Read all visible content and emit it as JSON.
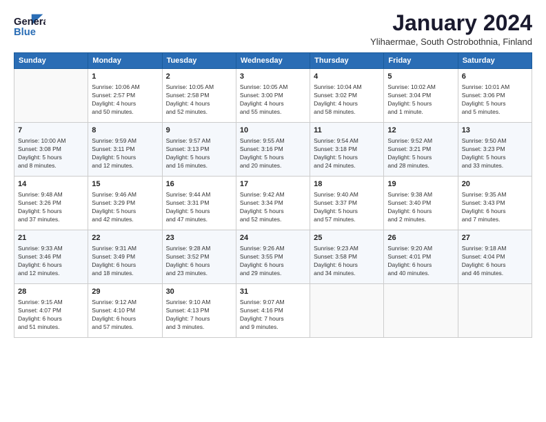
{
  "logo": {
    "line1": "General",
    "line2": "Blue"
  },
  "title": "January 2024",
  "subtitle": "Ylihaermae, South Ostrobothnia, Finland",
  "weekdays": [
    "Sunday",
    "Monday",
    "Tuesday",
    "Wednesday",
    "Thursday",
    "Friday",
    "Saturday"
  ],
  "weeks": [
    [
      {
        "day": "",
        "info": ""
      },
      {
        "day": "1",
        "info": "Sunrise: 10:06 AM\nSunset: 2:57 PM\nDaylight: 4 hours\nand 50 minutes."
      },
      {
        "day": "2",
        "info": "Sunrise: 10:05 AM\nSunset: 2:58 PM\nDaylight: 4 hours\nand 52 minutes."
      },
      {
        "day": "3",
        "info": "Sunrise: 10:05 AM\nSunset: 3:00 PM\nDaylight: 4 hours\nand 55 minutes."
      },
      {
        "day": "4",
        "info": "Sunrise: 10:04 AM\nSunset: 3:02 PM\nDaylight: 4 hours\nand 58 minutes."
      },
      {
        "day": "5",
        "info": "Sunrise: 10:02 AM\nSunset: 3:04 PM\nDaylight: 5 hours\nand 1 minute."
      },
      {
        "day": "6",
        "info": "Sunrise: 10:01 AM\nSunset: 3:06 PM\nDaylight: 5 hours\nand 5 minutes."
      }
    ],
    [
      {
        "day": "7",
        "info": "Sunrise: 10:00 AM\nSunset: 3:08 PM\nDaylight: 5 hours\nand 8 minutes."
      },
      {
        "day": "8",
        "info": "Sunrise: 9:59 AM\nSunset: 3:11 PM\nDaylight: 5 hours\nand 12 minutes."
      },
      {
        "day": "9",
        "info": "Sunrise: 9:57 AM\nSunset: 3:13 PM\nDaylight: 5 hours\nand 16 minutes."
      },
      {
        "day": "10",
        "info": "Sunrise: 9:55 AM\nSunset: 3:16 PM\nDaylight: 5 hours\nand 20 minutes."
      },
      {
        "day": "11",
        "info": "Sunrise: 9:54 AM\nSunset: 3:18 PM\nDaylight: 5 hours\nand 24 minutes."
      },
      {
        "day": "12",
        "info": "Sunrise: 9:52 AM\nSunset: 3:21 PM\nDaylight: 5 hours\nand 28 minutes."
      },
      {
        "day": "13",
        "info": "Sunrise: 9:50 AM\nSunset: 3:23 PM\nDaylight: 5 hours\nand 33 minutes."
      }
    ],
    [
      {
        "day": "14",
        "info": "Sunrise: 9:48 AM\nSunset: 3:26 PM\nDaylight: 5 hours\nand 37 minutes."
      },
      {
        "day": "15",
        "info": "Sunrise: 9:46 AM\nSunset: 3:29 PM\nDaylight: 5 hours\nand 42 minutes."
      },
      {
        "day": "16",
        "info": "Sunrise: 9:44 AM\nSunset: 3:31 PM\nDaylight: 5 hours\nand 47 minutes."
      },
      {
        "day": "17",
        "info": "Sunrise: 9:42 AM\nSunset: 3:34 PM\nDaylight: 5 hours\nand 52 minutes."
      },
      {
        "day": "18",
        "info": "Sunrise: 9:40 AM\nSunset: 3:37 PM\nDaylight: 5 hours\nand 57 minutes."
      },
      {
        "day": "19",
        "info": "Sunrise: 9:38 AM\nSunset: 3:40 PM\nDaylight: 6 hours\nand 2 minutes."
      },
      {
        "day": "20",
        "info": "Sunrise: 9:35 AM\nSunset: 3:43 PM\nDaylight: 6 hours\nand 7 minutes."
      }
    ],
    [
      {
        "day": "21",
        "info": "Sunrise: 9:33 AM\nSunset: 3:46 PM\nDaylight: 6 hours\nand 12 minutes."
      },
      {
        "day": "22",
        "info": "Sunrise: 9:31 AM\nSunset: 3:49 PM\nDaylight: 6 hours\nand 18 minutes."
      },
      {
        "day": "23",
        "info": "Sunrise: 9:28 AM\nSunset: 3:52 PM\nDaylight: 6 hours\nand 23 minutes."
      },
      {
        "day": "24",
        "info": "Sunrise: 9:26 AM\nSunset: 3:55 PM\nDaylight: 6 hours\nand 29 minutes."
      },
      {
        "day": "25",
        "info": "Sunrise: 9:23 AM\nSunset: 3:58 PM\nDaylight: 6 hours\nand 34 minutes."
      },
      {
        "day": "26",
        "info": "Sunrise: 9:20 AM\nSunset: 4:01 PM\nDaylight: 6 hours\nand 40 minutes."
      },
      {
        "day": "27",
        "info": "Sunrise: 9:18 AM\nSunset: 4:04 PM\nDaylight: 6 hours\nand 46 minutes."
      }
    ],
    [
      {
        "day": "28",
        "info": "Sunrise: 9:15 AM\nSunset: 4:07 PM\nDaylight: 6 hours\nand 51 minutes."
      },
      {
        "day": "29",
        "info": "Sunrise: 9:12 AM\nSunset: 4:10 PM\nDaylight: 6 hours\nand 57 minutes."
      },
      {
        "day": "30",
        "info": "Sunrise: 9:10 AM\nSunset: 4:13 PM\nDaylight: 7 hours\nand 3 minutes."
      },
      {
        "day": "31",
        "info": "Sunrise: 9:07 AM\nSunset: 4:16 PM\nDaylight: 7 hours\nand 9 minutes."
      },
      {
        "day": "",
        "info": ""
      },
      {
        "day": "",
        "info": ""
      },
      {
        "day": "",
        "info": ""
      }
    ]
  ]
}
